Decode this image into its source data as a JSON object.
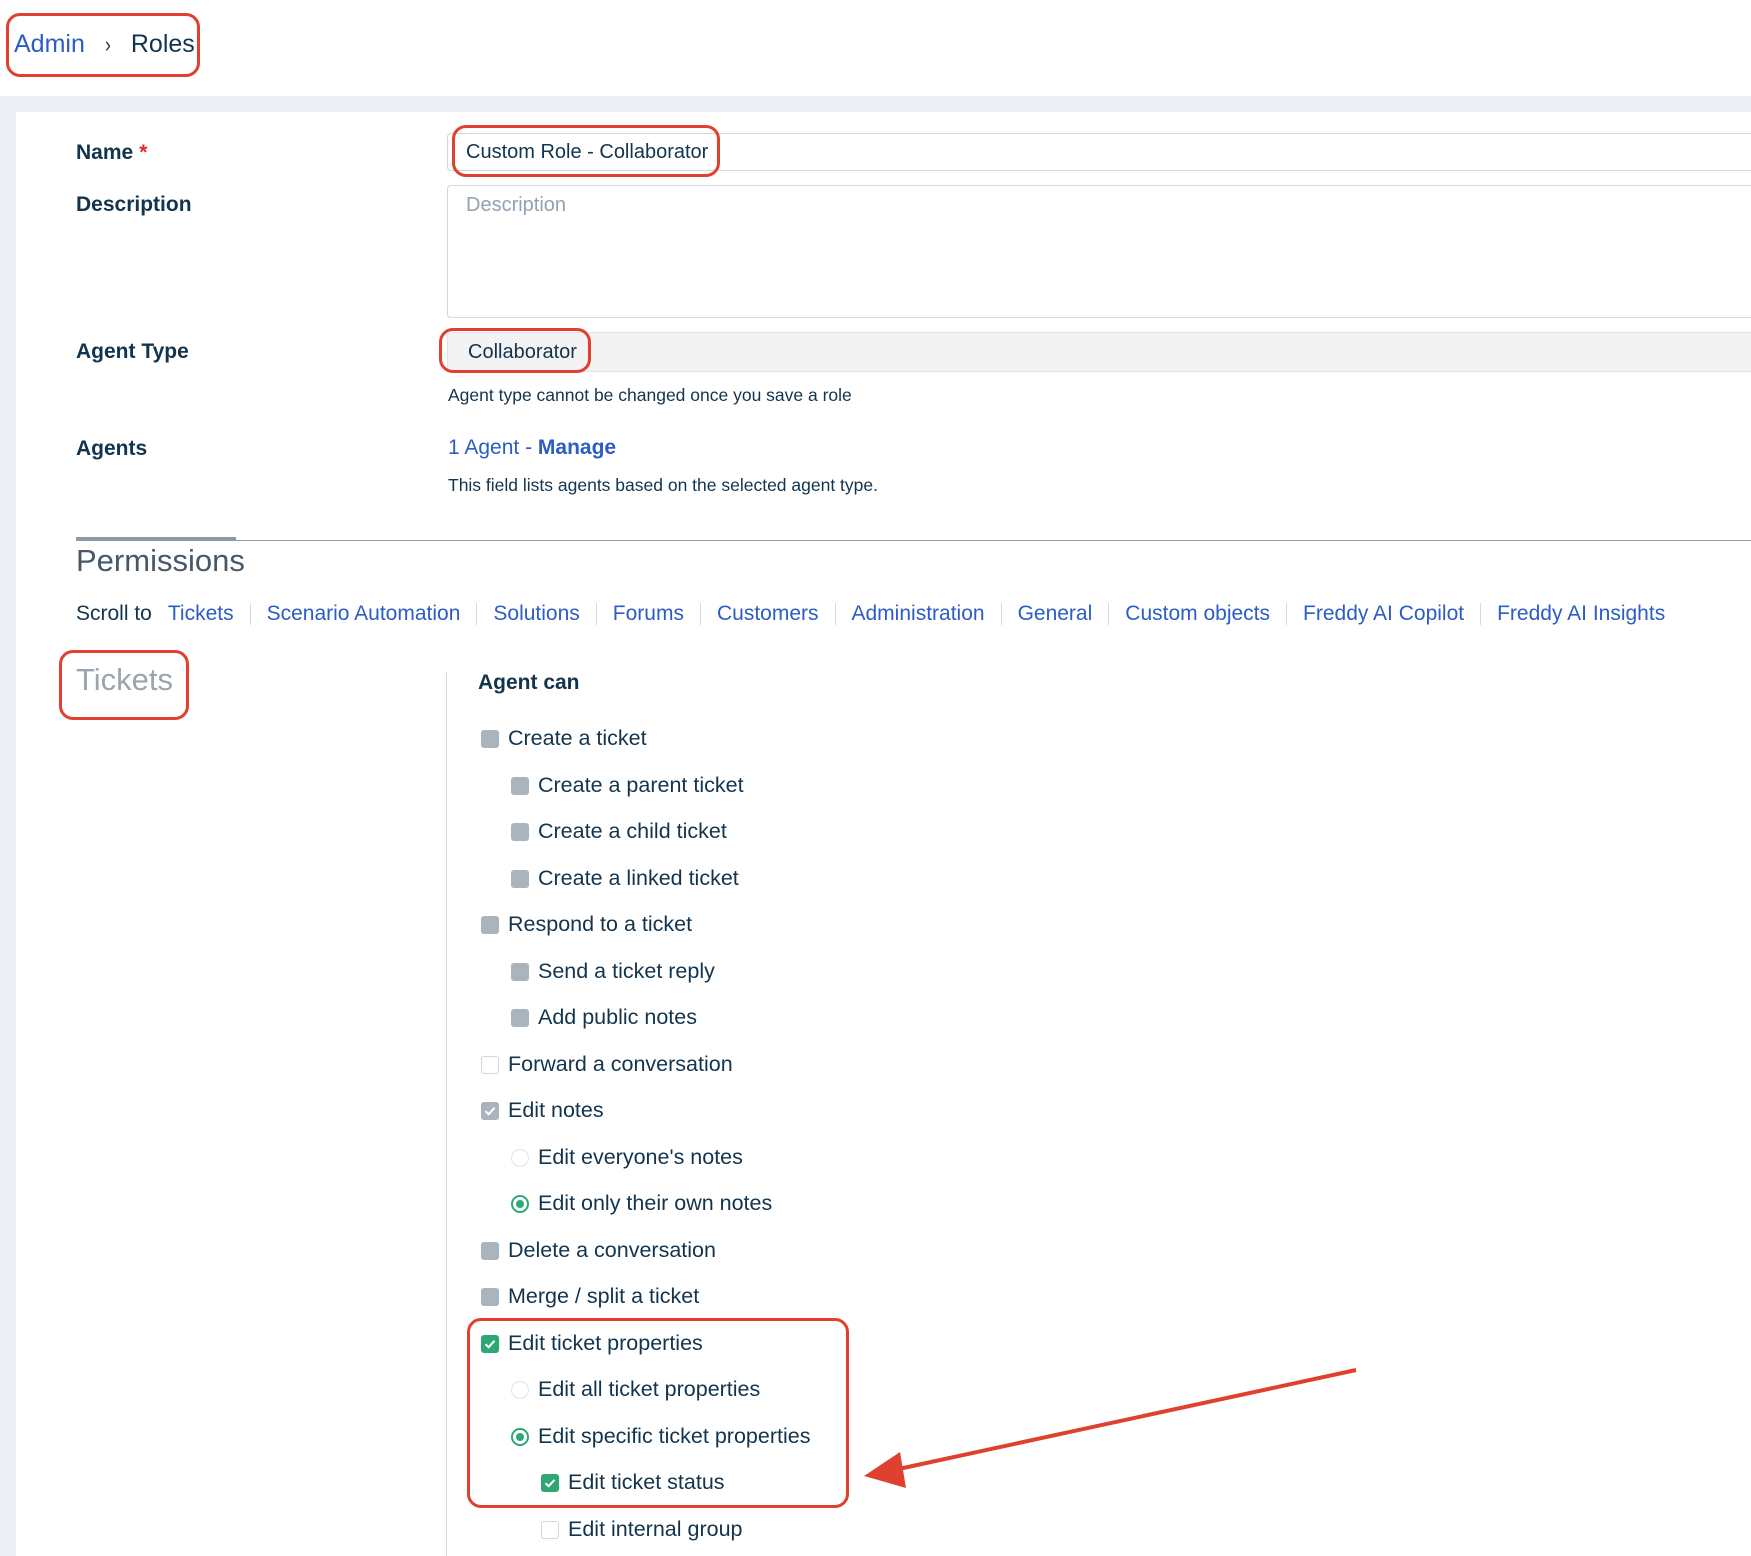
{
  "breadcrumb": {
    "admin": "Admin",
    "separator": "›",
    "current": "Roles"
  },
  "form": {
    "name_label": "Name",
    "required_mark": "*",
    "name_value": "Custom Role - Collaborator",
    "description_label": "Description",
    "description_placeholder": "Description",
    "agent_type_label": "Agent Type",
    "agent_type_value": "Collaborator",
    "agent_type_hint": "Agent type cannot be changed once you save a role",
    "agents_label": "Agents",
    "agents_count": "1 Agent",
    "agents_dash": " - ",
    "agents_manage": "Manage",
    "agents_hint": "This field lists agents based on the selected agent type."
  },
  "permissions": {
    "title": "Permissions",
    "scroll_to_label": "Scroll to",
    "scroll_links": [
      "Tickets",
      "Scenario Automation",
      "Solutions",
      "Forums",
      "Customers",
      "Administration",
      "General",
      "Custom objects",
      "Freddy AI Copilot",
      "Freddy AI Insights"
    ],
    "section_title": "Tickets",
    "agent_can": "Agent can",
    "items": [
      {
        "label": "Create a ticket",
        "control": "checkbox",
        "state": "disabled"
      },
      {
        "label": "Create a parent ticket",
        "control": "checkbox",
        "state": "disabled"
      },
      {
        "label": "Create a child ticket",
        "control": "checkbox",
        "state": "disabled"
      },
      {
        "label": "Create a linked ticket",
        "control": "checkbox",
        "state": "disabled"
      },
      {
        "label": "Respond to a ticket",
        "control": "checkbox",
        "state": "disabled"
      },
      {
        "label": "Send a ticket reply",
        "control": "checkbox",
        "state": "disabled"
      },
      {
        "label": "Add public notes",
        "control": "checkbox",
        "state": "disabled"
      },
      {
        "label": "Forward a conversation",
        "control": "checkbox",
        "state": "unchecked"
      },
      {
        "label": "Edit notes",
        "control": "checkbox",
        "state": "checked-disabled"
      },
      {
        "label": "Edit everyone's notes",
        "control": "radio",
        "state": "off"
      },
      {
        "label": "Edit only their own notes",
        "control": "radio",
        "state": "on"
      },
      {
        "label": "Delete a conversation",
        "control": "checkbox",
        "state": "disabled"
      },
      {
        "label": "Merge / split a ticket",
        "control": "checkbox",
        "state": "disabled"
      },
      {
        "label": "Edit ticket properties",
        "control": "checkbox",
        "state": "checked"
      },
      {
        "label": "Edit all ticket properties",
        "control": "radio",
        "state": "off"
      },
      {
        "label": "Edit specific ticket properties",
        "control": "radio",
        "state": "on"
      },
      {
        "label": "Edit ticket status",
        "control": "checkbox",
        "state": "checked"
      },
      {
        "label": "Edit internal group",
        "control": "checkbox",
        "state": "unchecked"
      }
    ]
  },
  "colors": {
    "link": "#2c5cc5",
    "text": "#12344d",
    "highlight": "#e0412f",
    "check_green": "#2fa774",
    "disabled_grey": "#a9b4bd"
  }
}
